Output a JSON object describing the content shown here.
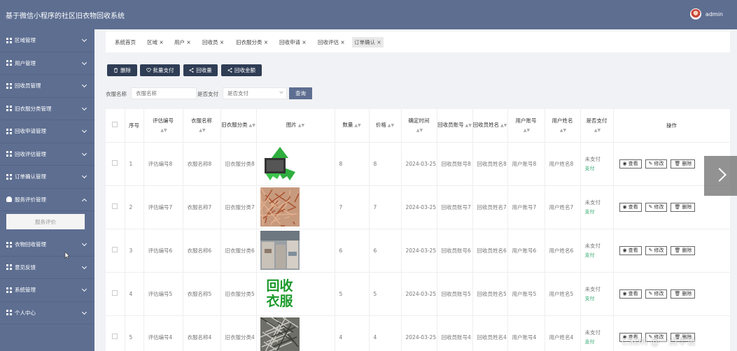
{
  "app": {
    "title": "基于微信小程序的社区旧衣物回收系统",
    "user": "admin"
  },
  "sidebar": {
    "items": [
      {
        "label": "区域管理",
        "icon": "grid-icon"
      },
      {
        "label": "用户管理",
        "icon": "grid-icon"
      },
      {
        "label": "回收员管理",
        "icon": "grid-icon"
      },
      {
        "label": "旧衣服分类管理",
        "icon": "grid-icon"
      },
      {
        "label": "回收申请管理",
        "icon": "grid-icon"
      },
      {
        "label": "回收评估管理",
        "icon": "grid-icon"
      },
      {
        "label": "订单确认管理",
        "icon": "grid-icon"
      },
      {
        "label": "服务评价管理",
        "icon": "person-icon",
        "expanded": true
      },
      {
        "label": "衣物回收管理",
        "icon": "grid-icon"
      },
      {
        "label": "意见反馈",
        "icon": "grid-icon"
      },
      {
        "label": "系统管理",
        "icon": "grid-icon"
      },
      {
        "label": "个人中心",
        "icon": "grid-icon"
      }
    ],
    "sub_item": "服务评价"
  },
  "tabs": [
    "系统首页",
    "区域",
    "用户",
    "回收员",
    "旧衣服分类",
    "回收申请",
    "回收评估",
    "订单确认"
  ],
  "toolbar": {
    "delete": "删除",
    "batch_pay": "批量支付",
    "recycle_amount": "回收量",
    "recycle_money": "回收金额"
  },
  "search": {
    "name_label": "衣服名称",
    "name_placeholder": "衣服名称",
    "pay_label": "是否支付",
    "pay_placeholder": "是否支付",
    "query": "查询"
  },
  "table": {
    "headers": [
      "序号",
      "评估编号",
      "衣服名称",
      "旧衣服分类",
      "图片",
      "数量",
      "价格",
      "确定时间",
      "回收员账号",
      "回收员姓名",
      "用户账号",
      "用户姓名",
      "是否支付",
      "操作"
    ],
    "rows": [
      {
        "no": "1",
        "eval_no": "评估编号8",
        "name": "衣服名称8",
        "category": "旧衣服分类8",
        "qty": "8",
        "price": "8",
        "time": "2024-03-25",
        "recycler_account": "回收员账号8",
        "recycler_name": "回收员姓名8",
        "user_account": "用户账号8",
        "user_name": "用户姓名8",
        "pay_state": "未支付",
        "pay_action": "支付",
        "image": "recycle-logo"
      },
      {
        "no": "2",
        "eval_no": "评估编号7",
        "name": "衣服名称7",
        "category": "旧衣服分类7",
        "qty": "7",
        "price": "7",
        "time": "2024-03-25",
        "recycler_account": "回收员账号7",
        "recycler_name": "回收员姓名7",
        "user_account": "用户账号7",
        "user_name": "用户姓名7",
        "pay_state": "未支付",
        "pay_action": "支付",
        "image": "copper-wire"
      },
      {
        "no": "3",
        "eval_no": "评估编号6",
        "name": "衣服名称6",
        "category": "旧衣服分类6",
        "qty": "6",
        "price": "6",
        "time": "2024-03-25",
        "recycler_account": "回收员账号6",
        "recycler_name": "回收员姓名6",
        "user_account": "用户账号6",
        "user_name": "用户姓名6",
        "pay_state": "未支付",
        "pay_action": "支付",
        "image": "warehouse"
      },
      {
        "no": "4",
        "eval_no": "评估编号5",
        "name": "衣服名称5",
        "category": "旧衣服分类5",
        "qty": "5",
        "price": "5",
        "time": "2024-03-25",
        "recycler_account": "回收员账号5",
        "recycler_name": "回收员姓名5",
        "user_account": "用户账号5",
        "user_name": "用户姓名5",
        "pay_state": "未支付",
        "pay_action": "支付",
        "image": "text-logo",
        "image_text_1": "回收",
        "image_text_2": "衣服"
      },
      {
        "no": "5",
        "eval_no": "评估编号4",
        "name": "衣服名称4",
        "category": "旧衣服分类4",
        "qty": "4",
        "price": "4",
        "time": "2024-03-25",
        "recycler_account": "回收员账号4",
        "recycler_name": "回收员姓名4",
        "user_account": "用户账号4",
        "user_name": "用户姓名4",
        "pay_state": "未支付",
        "pay_action": "支付",
        "image": "scrap-pile"
      }
    ],
    "ops": {
      "view": "查看",
      "edit": "修改",
      "delete": "删除"
    }
  },
  "watermark": "CSDN @一点毕设"
}
